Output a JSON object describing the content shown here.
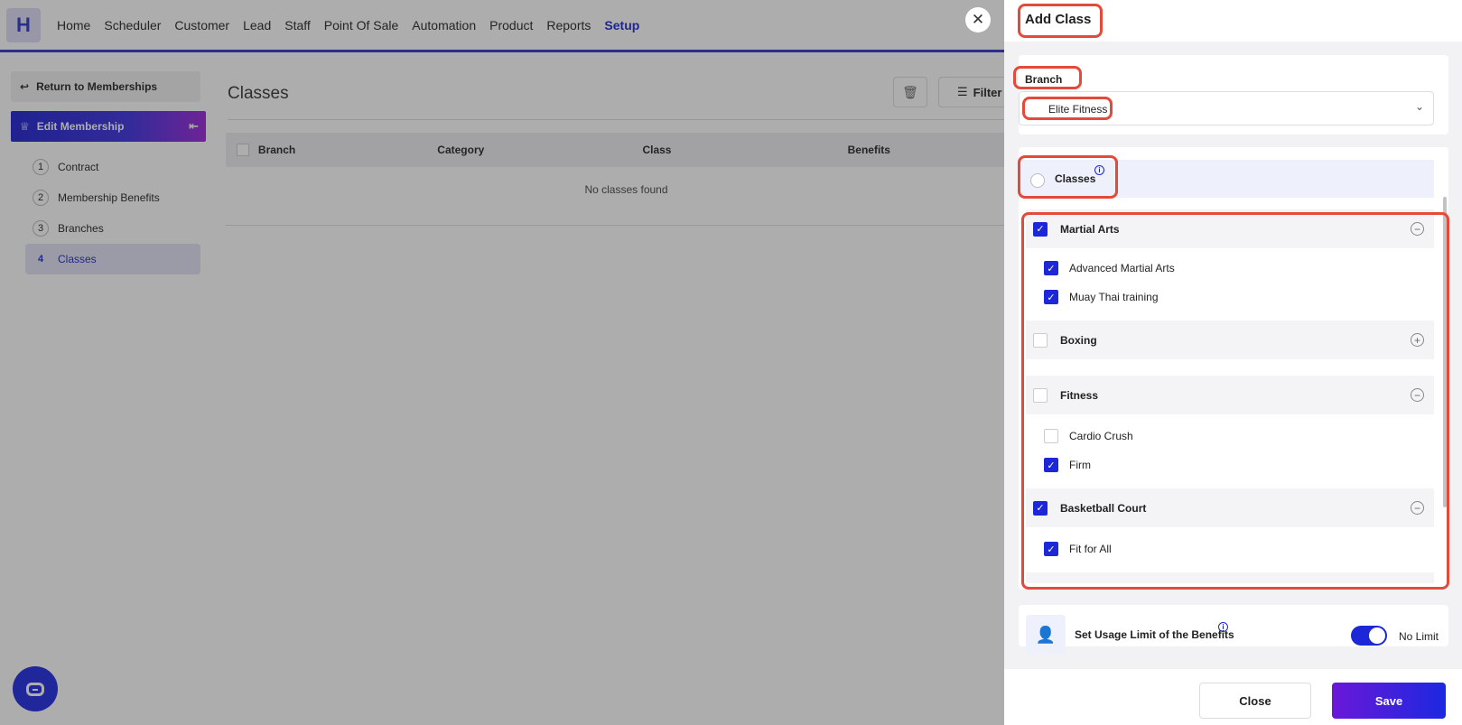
{
  "app": {
    "logo_letter": "H",
    "nav": [
      "Home",
      "Scheduler",
      "Customer",
      "Lead",
      "Staff",
      "Point Of Sale",
      "Automation",
      "Product",
      "Reports",
      "Setup"
    ],
    "active_nav": "Setup"
  },
  "sidebar": {
    "return_label": "Return to Memberships",
    "edit_label": "Edit Membership",
    "steps": [
      {
        "num": "1",
        "label": "Contract"
      },
      {
        "num": "2",
        "label": "Membership Benefits"
      },
      {
        "num": "3",
        "label": "Branches"
      },
      {
        "num": "4",
        "label": "Classes"
      }
    ],
    "active_step": "Classes"
  },
  "main": {
    "title": "Classes",
    "filter_label": "Filter",
    "columns": [
      "Branch",
      "Category",
      "Class",
      "Benefits"
    ],
    "empty_text": "No classes found"
  },
  "drawer": {
    "title": "Add Class",
    "branch_label": "Branch",
    "branch_value": "Elite Fitness",
    "classes_label": "Classes",
    "groups": [
      {
        "name": "Martial Arts",
        "checked": true,
        "expanded": true,
        "items": [
          {
            "name": "Advanced Martial Arts",
            "checked": true
          },
          {
            "name": "Muay Thai training",
            "checked": true
          }
        ]
      },
      {
        "name": "Boxing",
        "checked": false,
        "expanded": false,
        "items": []
      },
      {
        "name": "Fitness",
        "checked": false,
        "expanded": true,
        "items": [
          {
            "name": "Cardio Crush",
            "checked": false
          },
          {
            "name": "Firm",
            "checked": true
          }
        ]
      },
      {
        "name": "Basketball Court",
        "checked": true,
        "expanded": true,
        "items": [
          {
            "name": "Fit for All",
            "checked": true
          }
        ]
      }
    ],
    "usage_limit_label": "Set Usage Limit of the Benefits",
    "no_limit_label": "No Limit",
    "no_limit_on": true,
    "close_label": "Close",
    "save_label": "Save"
  },
  "colors": {
    "accent": "#1c28d8",
    "highlight": "#e44a3a"
  }
}
